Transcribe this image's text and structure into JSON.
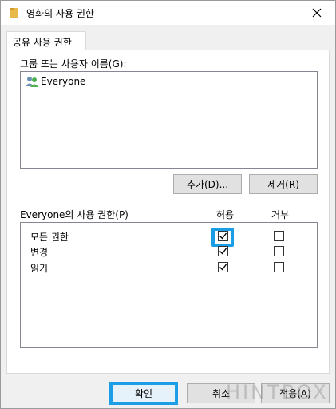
{
  "window": {
    "title": "영화의 사용 권한",
    "close_glyph": "✕"
  },
  "tab": {
    "label": "공유 사용 권한"
  },
  "groups": {
    "label": "그룹 또는 사용자 이름(G):",
    "items": [
      {
        "label": "Everyone",
        "icon": "users-icon"
      }
    ]
  },
  "buttons": {
    "add": "추가(D)...",
    "remove": "제거(R)",
    "ok": "확인",
    "cancel": "취소",
    "apply": "적용(A)"
  },
  "permissions": {
    "label": "Everyone의 사용 권한(P)",
    "col_allow": "허용",
    "col_deny": "거부",
    "rows": [
      {
        "label": "모든 권한",
        "allow": true,
        "deny": false
      },
      {
        "label": "변경",
        "allow": true,
        "deny": false
      },
      {
        "label": "읽기",
        "allow": true,
        "deny": false
      }
    ]
  },
  "watermark": "HINTBOX",
  "colors": {
    "highlight": "#1b9ee6",
    "folder": "#e8b84a"
  }
}
